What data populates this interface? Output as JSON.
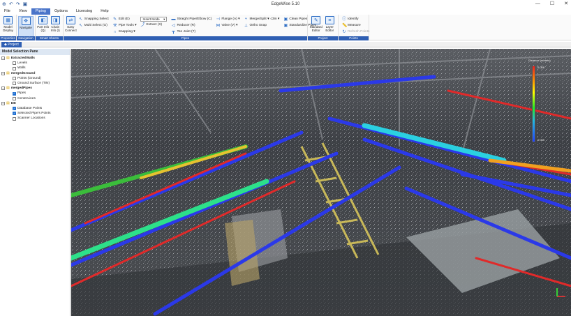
{
  "window": {
    "title": "EdgeWise 5.10",
    "controls": [
      "—",
      "☐",
      "✕"
    ]
  },
  "quick_access": [
    "⊕",
    "↶",
    "↷",
    "▣"
  ],
  "menu": [
    {
      "label": "File",
      "active": false
    },
    {
      "label": "View",
      "active": false
    },
    {
      "label": "Piping",
      "active": true
    },
    {
      "label": "Options",
      "active": false
    },
    {
      "label": "Licensing",
      "active": false
    },
    {
      "label": "Help",
      "active": false
    }
  ],
  "ribbon": {
    "properties": {
      "big": [
        {
          "label": "Model Display"
        }
      ],
      "group": "Properties"
    },
    "navigation": {
      "big": [
        {
          "label": "Navigate"
        }
      ],
      "group": "Navigation"
    },
    "smart_sheets": {
      "big": [
        {
          "label": "Part Info (Q)"
        },
        {
          "label": "Chain Info (I)"
        }
      ],
      "group": "Smart Sheets"
    },
    "pipes": {
      "easy_connect": "Easy Connect",
      "col1": [
        "Snapping Select",
        "Multi Select (G)"
      ],
      "col2": [
        "Edit (E)",
        "Pipe Tools ▾",
        "Snapping ▾"
      ],
      "insert_mode": "Insert Mode",
      "extract": "Extract (X)",
      "col4": [
        "Straight Pipe/Elbow (C)",
        "Reducer (R)",
        "Tee Joint (T)"
      ],
      "col5": [
        "Flange (A) ▾",
        "Valve (V) ▾"
      ],
      "col6": [
        "Merge/Split ▾",
        "Ortho Snap"
      ],
      "col6_extra": "c3m ▾",
      "col7": [
        "Clean Pipes",
        "Standardize Pipes"
      ],
      "group": "Pipes"
    },
    "project": {
      "big": [
        {
          "label": "Standard Editor"
        },
        {
          "label": "Layer Editor"
        }
      ],
      "group": "Project"
    },
    "points": {
      "items": [
        "Identify",
        "Measure",
        "Refresh Points"
      ],
      "group": "Points"
    }
  },
  "doc_tab": "Project",
  "pane": {
    "title": "Model Selection Pane",
    "tree": [
      {
        "label": "ExtractedWalls",
        "bold": true,
        "children": [
          {
            "label": "Levels",
            "checked": false
          },
          {
            "label": "Walls",
            "checked": false
          }
        ]
      },
      {
        "label": "mergedGround",
        "bold": true,
        "children": [
          {
            "label": "Points (Ground)",
            "checked": false
          },
          {
            "label": "Ground Surface (TIN)",
            "checked": false
          }
        ]
      },
      {
        "label": "mergedPipes",
        "bold": true,
        "children": [
          {
            "label": "Pipes",
            "checked": true
          },
          {
            "label": "CenterLines",
            "checked": false
          }
        ]
      },
      {
        "label": "DB",
        "bold": true,
        "children": [
          {
            "label": "Database Points",
            "checked": true
          },
          {
            "label": "Selected Pipe's Points",
            "checked": true
          },
          {
            "label": "Scanner Locations",
            "checked": false
          }
        ]
      }
    ]
  },
  "colorbar": {
    "title": "Distance (meters)",
    "top": "0.006",
    "bottom": "0.000"
  },
  "colors": {
    "accent": "#2f5fb3",
    "active_menu": "#4a74c9"
  }
}
